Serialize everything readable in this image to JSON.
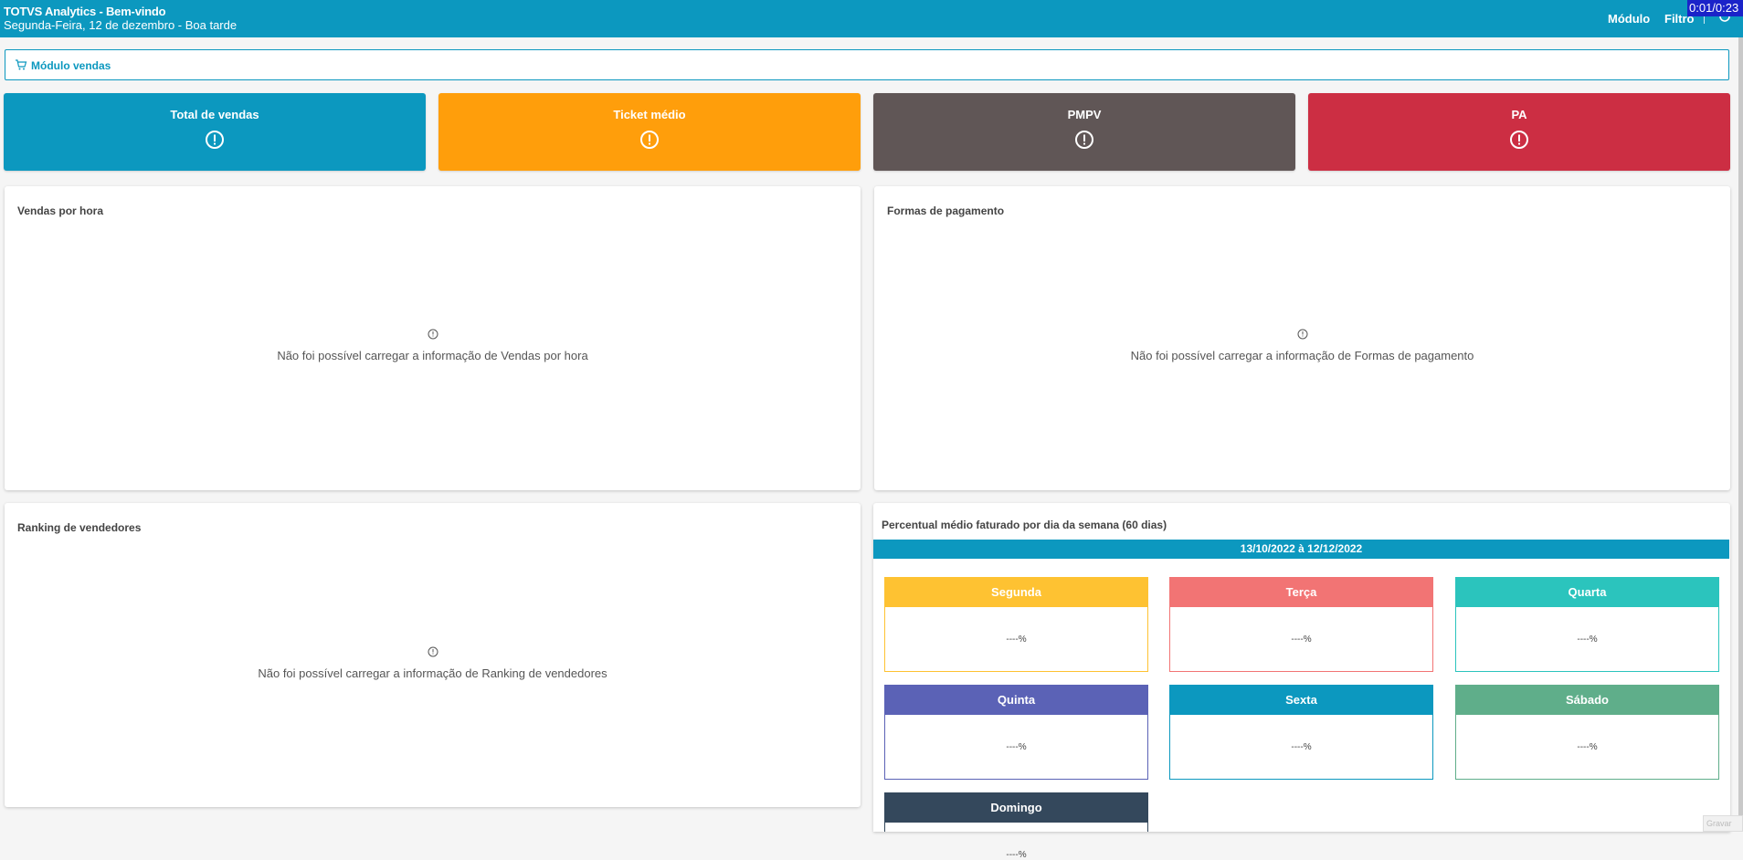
{
  "header": {
    "title": "TOTVS Analytics - Bem-vindo",
    "subtitle": "Segunda-Feira, 12 de dezembro - Boa tarde",
    "nav_modulo": "Módulo",
    "nav_filtro": "Filtro",
    "timer": "0:01/0:23"
  },
  "module_bar": {
    "label": "Módulo vendas",
    "icon": "cart-icon"
  },
  "kpis": [
    {
      "label": "Total de vendas",
      "color": "#0c98bf",
      "icon": "alert-circle-icon"
    },
    {
      "label": "Ticket médio",
      "color": "#ff9e0b",
      "icon": "alert-circle-icon"
    },
    {
      "label": "PMPV",
      "color": "#605656",
      "icon": "alert-circle-icon"
    },
    {
      "label": "PA",
      "color": "#cc2e43",
      "icon": "alert-circle-icon"
    }
  ],
  "cards": {
    "vendas_hora": {
      "title": "Vendas por hora",
      "error": "Não foi possível carregar a informação de Vendas por hora"
    },
    "formas_pagamento": {
      "title": "Formas de pagamento",
      "error": "Não foi possível carregar a informação de Formas de pagamento"
    },
    "ranking": {
      "title": "Ranking de vendedores",
      "error": "Não foi possível carregar a informação de Ranking de vendedores"
    }
  },
  "weekdays_card": {
    "title": "Percentual médio faturado por dia da semana (60 dias)",
    "date_range": "13/10/2022 à 12/12/2022",
    "days": [
      {
        "name": "Segunda",
        "value": "----%",
        "color": "#fec232"
      },
      {
        "name": "Terça",
        "value": "----%",
        "color": "#f27474"
      },
      {
        "name": "Quarta",
        "value": "----%",
        "color": "#2bc4bd"
      },
      {
        "name": "Quinta",
        "value": "----%",
        "color": "#5b62b6"
      },
      {
        "name": "Sexta",
        "value": "----%",
        "color": "#0c98bf"
      },
      {
        "name": "Sábado",
        "value": "----%",
        "color": "#5fae8a"
      },
      {
        "name": "Domingo",
        "value": "----%",
        "color": "#34485c"
      }
    ]
  },
  "corner_button": "Gravar"
}
